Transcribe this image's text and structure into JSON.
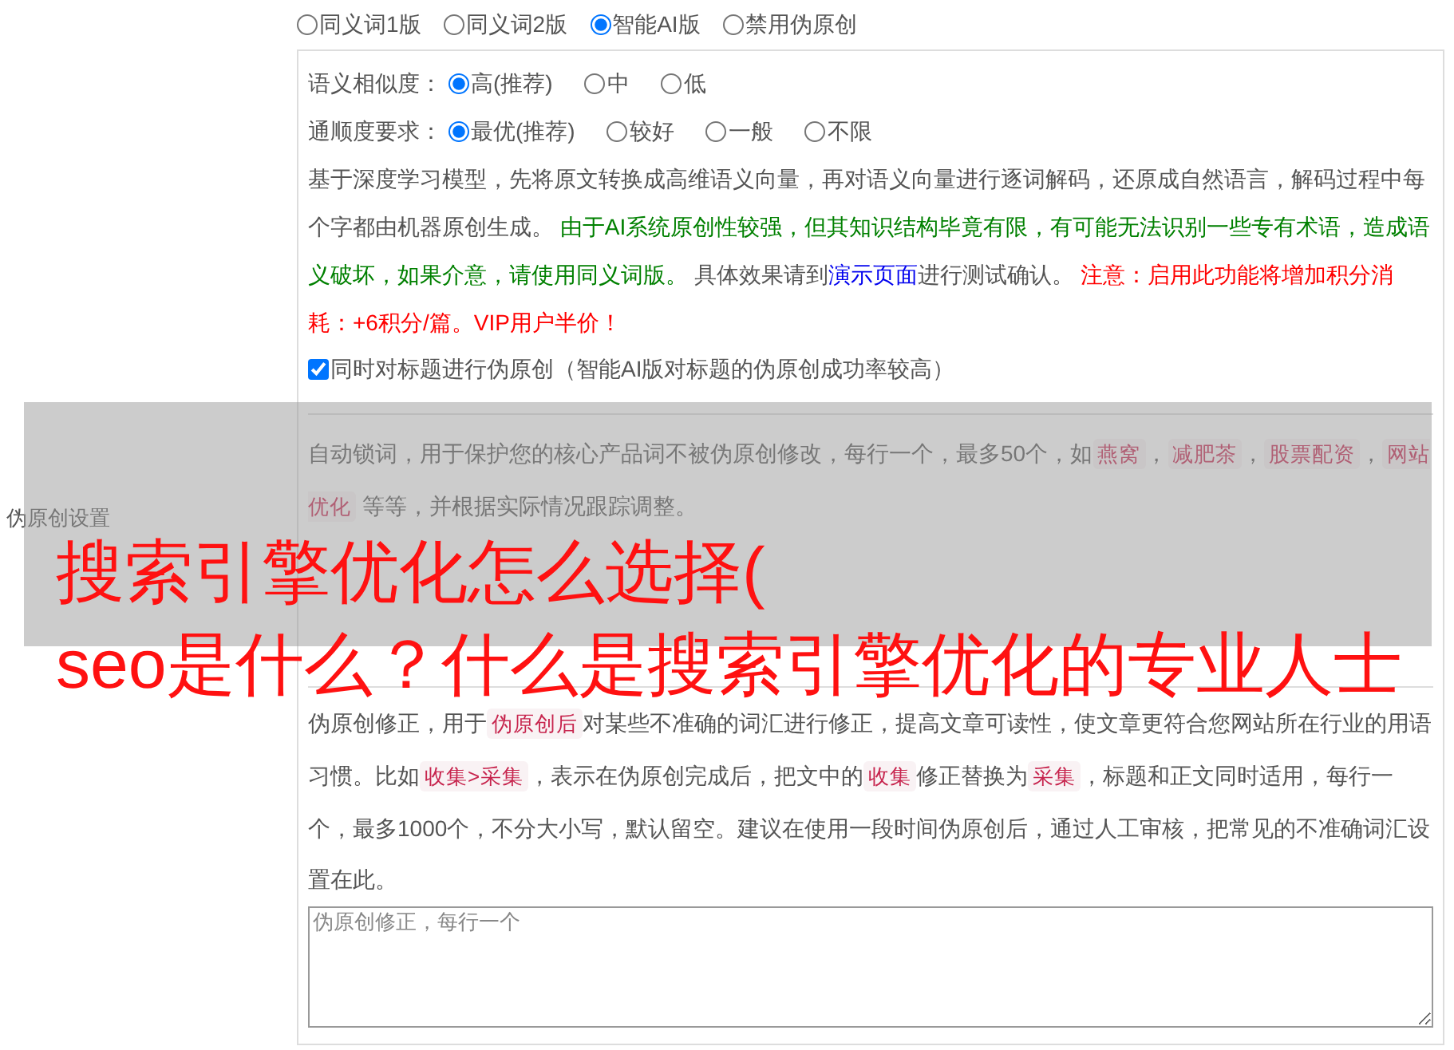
{
  "section_label": "伪原创设置",
  "modes": [
    {
      "label": "同义词1版",
      "selected": false
    },
    {
      "label": "同义词2版",
      "selected": false
    },
    {
      "label": "智能AI版",
      "selected": true
    },
    {
      "label": "禁用伪原创",
      "selected": false
    }
  ],
  "similarity": {
    "label": "语义相似度：",
    "options": [
      {
        "label": "高(推荐)",
        "selected": true
      },
      {
        "label": "中",
        "selected": false
      },
      {
        "label": "低",
        "selected": false
      }
    ]
  },
  "fluency": {
    "label": "通顺度要求：",
    "options": [
      {
        "label": "最优(推荐)",
        "selected": true
      },
      {
        "label": "较好",
        "selected": false
      },
      {
        "label": "一般",
        "selected": false
      },
      {
        "label": "不限",
        "selected": false
      }
    ]
  },
  "description": [
    {
      "kind": "plain",
      "text": "基于深度学习模型，先将原文转换成高维语义向量，再对语义向量进行逐词解码，还原成自然语言，解码过程中每个字都由机器原创生成。 "
    },
    {
      "kind": "notice",
      "text": "由于AI系统原创性较强，但其知识结构毕竟有限，有可能无法识别一些专有术语，造成语义破坏，如果介意，请使用同义词版。"
    },
    {
      "kind": "plain",
      "text": " 具体效果请到"
    },
    {
      "kind": "link",
      "text": "演示页面"
    },
    {
      "kind": "plain",
      "text": "进行测试确认。 "
    },
    {
      "kind": "warning",
      "text": "注意：启用此功能将增加积分消耗：+6积分/篇。VIP用户半价！"
    }
  ],
  "title_option": {
    "label": "同时对标题进行伪原创（智能AI版对标题的伪原创成功率较高）",
    "checked": true
  },
  "lock_words": [
    {
      "kind": "text",
      "text": "自动锁词，用于保护您的核心产品词不被伪原创修改，每行一个，最多50个，如"
    },
    {
      "kind": "tag",
      "text": "燕窝"
    },
    {
      "kind": "text",
      "text": "，"
    },
    {
      "kind": "tag",
      "text": "减肥茶"
    },
    {
      "kind": "text",
      "text": "，"
    },
    {
      "kind": "tag",
      "text": "股票配资"
    },
    {
      "kind": "text",
      "text": "，"
    },
    {
      "kind": "tag",
      "text": "网站优化"
    },
    {
      "kind": "text",
      "text": " 等等，并根据实际情况跟踪调整。"
    }
  ],
  "corrections": {
    "parts": [
      {
        "kind": "text",
        "text": "伪原创修正，用于"
      },
      {
        "kind": "tag",
        "text": "伪原创后"
      },
      {
        "kind": "text",
        "text": "对某些不准确的词汇进行修正，提高文章可读性，使文章更符合您网站所在行业的用语习惯。比如"
      },
      {
        "kind": "tag",
        "text": "收集>采集"
      },
      {
        "kind": "text",
        "text": "，表示在伪原创完成后，把文中的"
      },
      {
        "kind": "tag",
        "text": "收集"
      },
      {
        "kind": "text",
        "text": "修正替换为"
      },
      {
        "kind": "tag",
        "text": "采集"
      },
      {
        "kind": "text",
        "text": "，标题和正文同时适用，每行一个，最多1000个，不分大小写，默认留空。建议在使用一段时间伪原创后，通过人工审核，把常见的不准确词汇设置在此。"
      }
    ],
    "placeholder": "伪原创修正，每行一个"
  },
  "overlay_title": [
    "搜索引擎优化怎么选择(",
    "seo是什么？什么是搜索引擎优化的专业人士"
  ]
}
